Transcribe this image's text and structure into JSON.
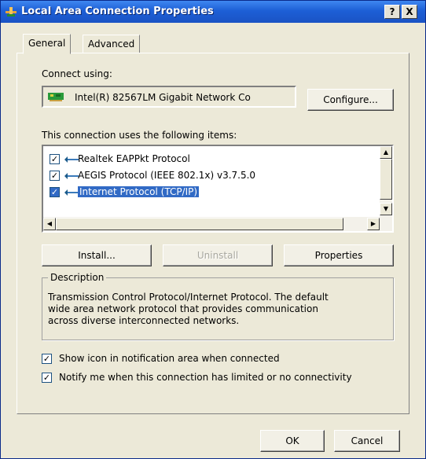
{
  "window": {
    "title": "Local Area Connection Properties",
    "help_btn": "?",
    "close_btn": "X"
  },
  "tabs": [
    {
      "label": "General",
      "active": true
    },
    {
      "label": "Advanced",
      "active": false
    }
  ],
  "connect": {
    "label": "Connect using:",
    "adapter": "Intel(R) 82567LM Gigabit Network Co",
    "configure_btn": "Configure..."
  },
  "items": {
    "label": "This connection uses the following items:",
    "list": [
      {
        "label": "Realtek EAPPkt Protocol",
        "checked": true
      },
      {
        "label": "AEGIS Protocol (IEEE 802.1x) v3.7.5.0",
        "checked": true
      },
      {
        "label": "Internet Protocol (TCP/IP)",
        "checked": true,
        "selected": true
      }
    ],
    "scroll_up": "▲",
    "scroll_down": "▼",
    "scroll_left": "◀",
    "scroll_right": "▶"
  },
  "buttons": {
    "install": "Install...",
    "uninstall": "Uninstall",
    "properties": "Properties"
  },
  "description": {
    "legend": "Description",
    "lines": [
      "Transmission Control Protocol/Internet Protocol. The default",
      "wide area network protocol that provides communication",
      "across diverse interconnected networks."
    ]
  },
  "options": {
    "show_icon": "Show icon in notification area when connected",
    "notify": "Notify me when this connection has limited or no connectivity",
    "check_mark": "✓"
  },
  "footer": {
    "ok": "OK",
    "cancel": "Cancel"
  },
  "colors": {
    "titlebar": "#1d5fd6",
    "dialog_bg": "#ece9d8",
    "selection": "#316ac5"
  },
  "icons": {
    "title": "network-connection-icon",
    "adapter": "network-card-icon",
    "protocol": "protocol-icon"
  }
}
